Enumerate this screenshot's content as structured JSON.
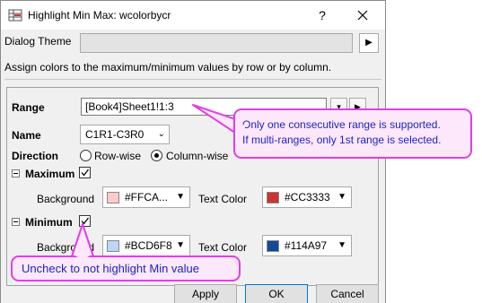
{
  "window": {
    "title": "Highlight Min Max: wcolorbycr",
    "help_glyph": "?",
    "close_glyph": "✕"
  },
  "theme": {
    "label": "Dialog Theme",
    "value": "",
    "arrow": "▶"
  },
  "hint": "Assign colors to the maximum/minimum values by row or by column.",
  "range": {
    "label": "Range",
    "value": "[Book4]Sheet1!1:3",
    "select_btn": "▾",
    "arrow_btn": "▶"
  },
  "name": {
    "label": "Name",
    "value": "C1R1-C3R0"
  },
  "direction": {
    "label": "Direction",
    "options": [
      "Row-wise",
      "Column-wise"
    ],
    "selected": "Column-wise"
  },
  "maximum": {
    "label": "Maximum",
    "checked": true,
    "background_label": "Background",
    "background_value": "#FFCA...",
    "background_color": "#FFCACA",
    "textcolor_label": "Text Color",
    "textcolor_value": "#CC3333",
    "textcolor_color": "#CC3333"
  },
  "minimum": {
    "label": "Minimum",
    "checked": true,
    "background_label": "Background",
    "background_value": "#BCD6F8",
    "background_color": "#BCD6F8",
    "textcolor_label": "Text Color",
    "textcolor_value": "#114A97",
    "textcolor_color": "#114A97"
  },
  "buttons": {
    "apply": "Apply",
    "ok": "OK",
    "cancel": "Cancel"
  },
  "annotations": {
    "callout_range_line1": "Only one consecutive range is supported.",
    "callout_range_line2": "If multi-ranges, only 1st range is selected.",
    "callout_minimum": "Uncheck to not highlight Min value",
    "callout_color": "#E13EE5"
  }
}
